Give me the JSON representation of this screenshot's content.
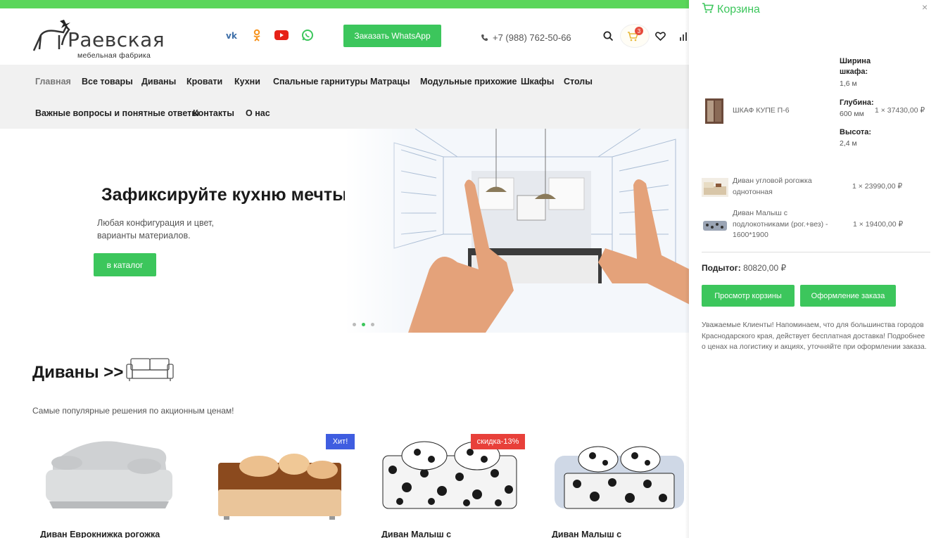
{
  "brand": {
    "name": "Раевская",
    "tagline": "мебельная фабрика",
    "accent_color": "#3cc65c",
    "topbar_color": "#5ad65a"
  },
  "header": {
    "social_icons": [
      "vk-icon",
      "odnoklassniki-icon",
      "youtube-icon",
      "whatsapp-icon"
    ],
    "whatsapp_button": "Заказать WhatsApp",
    "phone": "+7 (988) 762-50-66",
    "cart_count": "3"
  },
  "nav": {
    "row1": [
      "Главная",
      "Все товары",
      "Диваны",
      "Кровати",
      "Кухни",
      "Спальные гарнитуры",
      "Матрацы",
      "Модульные прихожие",
      "Шкафы",
      "Столы"
    ],
    "row2": [
      "Важные вопросы и понятные ответы",
      "Контакты",
      "О нас"
    ]
  },
  "hero": {
    "title": "Зафиксируйте кухню мечты!",
    "subtitle": "Любая конфигурация и цвет, варианты материалов.",
    "button": "в каталог"
  },
  "section": {
    "title": "Диваны >>",
    "subtitle": "Самые популярные решения по акционным ценам!"
  },
  "products": [
    {
      "name": "Диван Еврокнижка рогожка",
      "tag": ""
    },
    {
      "name": "",
      "tag": "Хит!",
      "tag_color": "#3f5de0"
    },
    {
      "name": "Диван Малыш с",
      "tag": "скидка-13%",
      "tag_color": "#e8403a"
    },
    {
      "name": "Диван Малыш с",
      "tag": ""
    }
  ],
  "cart": {
    "title": "Корзина",
    "close": "×",
    "item1": {
      "attrs": [
        {
          "label": "Ширина шкафа:",
          "value": "1,6 м"
        },
        {
          "label": "Глубина:",
          "value": "600 мм"
        },
        {
          "label": "Высота:",
          "value": "2,4 м"
        }
      ],
      "name": "ШКАФ КУПЕ П-6",
      "price": "1 × 37430,00 ₽"
    },
    "item2": {
      "name": "Диван угловой рогожка однотонная",
      "price": "1 × 23990,00 ₽"
    },
    "item3": {
      "name": "Диван Малыш с подлокотниками (рог.+вез) - 1600*1900",
      "price": "1 × 19400,00 ₽"
    },
    "subtotal_label": "Подытог:",
    "subtotal_value": "80820,00 ₽",
    "view_button": "Просмотр корзины",
    "checkout_button": "Оформление заказа",
    "note": "Уважаемые Клиенты! Напоминаем, что для большинства городов Краснодарского края, действует бесплатная доставка! Подробнее о ценах на логистику и акциях, уточняйте при оформлении заказа."
  }
}
